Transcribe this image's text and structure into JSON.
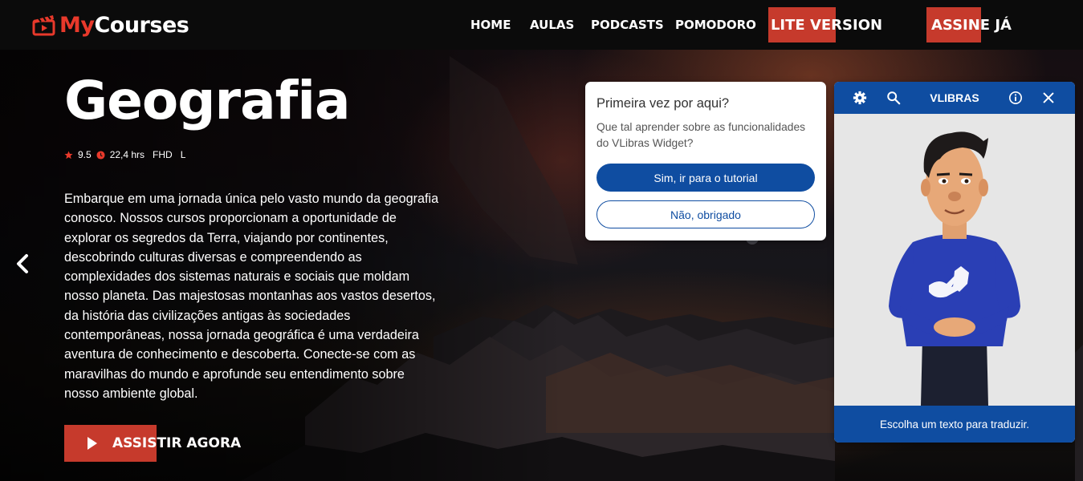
{
  "header": {
    "logo": {
      "part1": "My",
      "part2": "Courses"
    },
    "nav": [
      {
        "label": "HOME"
      },
      {
        "label": "AULAS"
      },
      {
        "label": "PODCASTS"
      },
      {
        "label": "POMODORO"
      }
    ],
    "lite_button": "LITE VERSION",
    "subscribe_button": "ASSINE JÁ"
  },
  "hero": {
    "title": "Geografia",
    "rating": "9.5",
    "duration": "22,4 hrs",
    "quality": "FHD",
    "age_rating": "L",
    "description": "Embarque em uma jornada única pelo vasto mundo da geografia conosco. Nossos cursos proporcionam a oportunidade de explorar os segredos da Terra, viajando por continentes, descobrindo culturas diversas e compreendendo as complexidades dos sistemas naturais e sociais que moldam nosso planeta. Das majestosas montanhas aos vastos desertos, da história das civilizações antigas às sociedades contemporâneas, nossa jornada geográfica é uma verdadeira aventura de conhecimento e descoberta. Conecte-se com as maravilhas do mundo e aprofunde seu entendimento sobre nosso ambiente global.",
    "watch_button": "ASSISTIR AGORA"
  },
  "vlibras_prompt": {
    "title": "Primeira vez por aqui?",
    "text": "Que tal aprender sobre as funcionalidades do VLibras Widget?",
    "yes_button": "Sim, ir para o tutorial",
    "no_button": "Não, obrigado"
  },
  "vlibras_widget": {
    "title": "VLIBRAS",
    "footer_text": "Escolha um texto para traduzir."
  },
  "icons": {
    "logo": "clapperboard-icon",
    "star": "star-icon",
    "clock": "clock-icon",
    "play": "play-icon",
    "prev": "chevron-left-icon",
    "settings": "gear-icon",
    "search": "search-icon",
    "info": "info-icon",
    "close": "close-icon"
  },
  "colors": {
    "accent_red": "#c63a2c",
    "vlibras_blue": "#0f4da1",
    "header_bg": "#0b0b0b"
  }
}
